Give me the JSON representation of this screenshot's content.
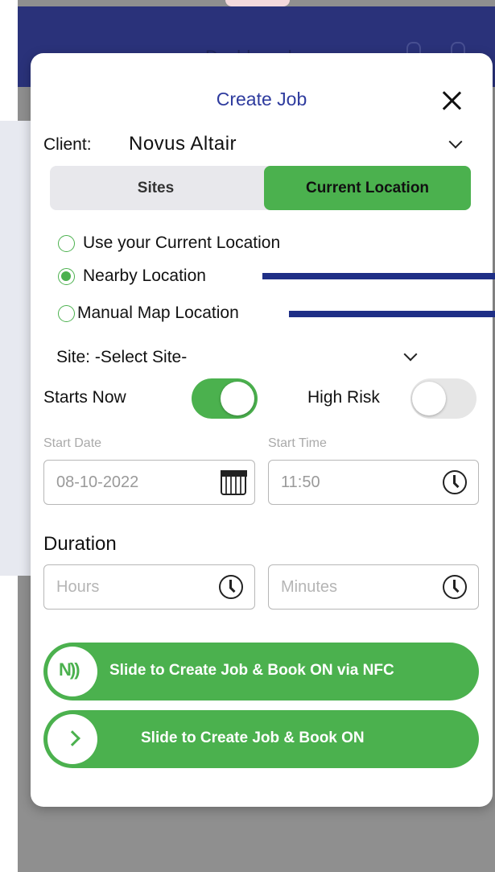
{
  "background": {
    "app_title": "Dashboard"
  },
  "modal": {
    "title": "Create Job",
    "client_label": "Client:",
    "client_value": "Novus Altair",
    "segments": {
      "sites": "Sites",
      "current_location": "Current Location"
    },
    "location_options": [
      {
        "label": "Use your Current Location",
        "checked": false
      },
      {
        "label": "Nearby Location",
        "checked": true
      },
      {
        "label": "Manual Map Location",
        "checked": false
      }
    ],
    "site_label": "Site:  -Select Site-",
    "starts_now_label": "Starts Now",
    "starts_now_on": true,
    "high_risk_label": "High Risk",
    "high_risk_on": false,
    "start_date_label": "Start Date",
    "start_date_value": "08-10-2022",
    "start_time_label": "Start Time",
    "start_time_value": "11:50",
    "duration_title": "Duration",
    "hours_placeholder": "Hours",
    "minutes_placeholder": "Minutes",
    "slide_nfc_label": "Slide to Create Job & Book ON via NFC",
    "slide_book_label": "Slide to Create Job & Book ON"
  },
  "colors": {
    "accent_green": "#4bb14e",
    "title_blue": "#2e3b9e",
    "topbar_navy": "#2a327a",
    "annotation_navy": "#1f2f86"
  },
  "icons": [
    "menu-icon",
    "bell-icon",
    "close-icon",
    "chevron-down-icon",
    "calendar-icon",
    "clock-icon",
    "nfc-icon",
    "chevron-right-icon"
  ]
}
